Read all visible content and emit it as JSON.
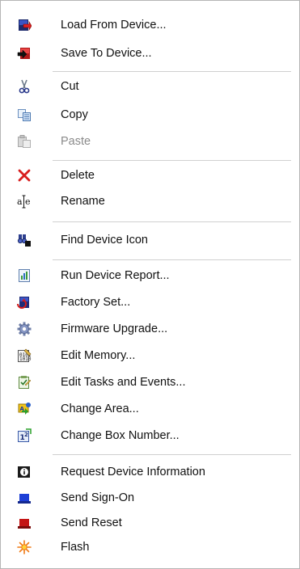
{
  "menu": {
    "items": [
      {
        "label": "Load From Device...",
        "icon": "load-from-device-icon",
        "enabled": true
      },
      {
        "label": "Save To Device...",
        "icon": "save-to-device-icon",
        "enabled": true
      },
      {
        "label": "Cut",
        "icon": "scissors-icon",
        "enabled": true
      },
      {
        "label": "Copy",
        "icon": "copy-icon",
        "enabled": true
      },
      {
        "label": "Paste",
        "icon": "paste-icon",
        "enabled": false
      },
      {
        "label": "Delete",
        "icon": "delete-x-icon",
        "enabled": true
      },
      {
        "label": "Rename",
        "icon": "rename-icon",
        "enabled": true
      },
      {
        "label": "Find Device Icon",
        "icon": "binoculars-icon",
        "enabled": true
      },
      {
        "label": "Run Device Report...",
        "icon": "report-icon",
        "enabled": true
      },
      {
        "label": "Factory Set...",
        "icon": "factory-set-icon",
        "enabled": true
      },
      {
        "label": "Firmware Upgrade...",
        "icon": "gear-icon",
        "enabled": true
      },
      {
        "label": "Edit Memory...",
        "icon": "edit-memory-icon",
        "enabled": true
      },
      {
        "label": "Edit Tasks and Events...",
        "icon": "edit-tasks-icon",
        "enabled": true
      },
      {
        "label": "Change Area...",
        "icon": "change-area-icon",
        "enabled": true
      },
      {
        "label": "Change Box Number...",
        "icon": "change-box-number-icon",
        "enabled": true
      },
      {
        "label": "Request Device Information",
        "icon": "info-icon",
        "enabled": true
      },
      {
        "label": "Send Sign-On",
        "icon": "sign-on-icon",
        "enabled": true
      },
      {
        "label": "Send Reset",
        "icon": "reset-icon",
        "enabled": true
      },
      {
        "label": "Flash",
        "icon": "flash-icon",
        "enabled": true
      }
    ]
  },
  "colors": {
    "text": "#111111",
    "disabled_text": "#8a8a8a",
    "separator": "#d0d0d0",
    "border": "#b5b5b5"
  }
}
